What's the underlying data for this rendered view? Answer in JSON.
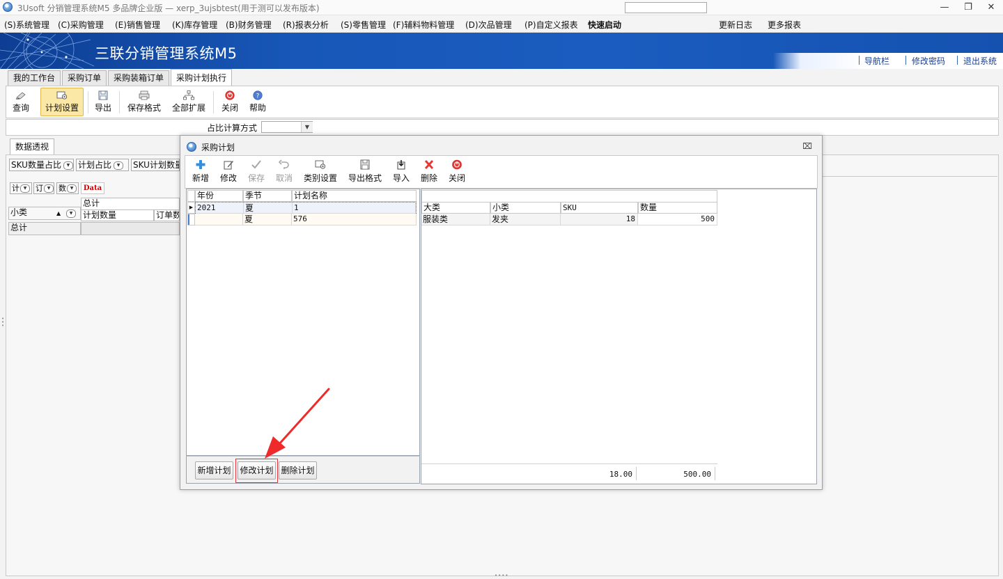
{
  "window": {
    "title": "3Usoft 分销管理系统M5 多品牌企业版 — xerp_3ujsbtest(用于测可以发布版本)",
    "minimize_icon": "minimize-icon",
    "restore_icon": "restore-icon",
    "close_icon": "close-icon"
  },
  "menu": {
    "items": [
      "(S)系统管理",
      "(C)采购管理",
      "(E)销售管理",
      "(K)库存管理",
      "(B)财务管理",
      "(R)报表分析",
      "(S)零售管理",
      "(F)辅料物料管理",
      "(D)次品管理",
      "(P)自定义报表"
    ],
    "quick_start_label": "快速启动",
    "quick_start_value": "",
    "update_log": "更新日志",
    "more_reports": "更多报表"
  },
  "banner": {
    "title": "三联分销管理系统M5",
    "nav_bar": "导航栏",
    "change_password": "修改密码",
    "exit_system": "退出系统"
  },
  "tabs": [
    "我的工作台",
    "采购订单",
    "采购装箱订单",
    "采购计划执行"
  ],
  "active_tab": "采购计划执行",
  "toolbar": {
    "query": "查询",
    "plan_settings": "计划设置",
    "export": "导出",
    "save_format": "保存格式",
    "expand_all": "全部扩展",
    "close": "关闭",
    "help": "帮助"
  },
  "ratio": {
    "label": "占比计算方式",
    "value": ""
  },
  "pivot": {
    "tab": "数据透视",
    "fields": [
      "SKU数量占比",
      "计划占比",
      "SKU计划数量"
    ],
    "small_fields": [
      "计",
      "订",
      "数"
    ],
    "data_label": "Data",
    "header_total": "总计",
    "col_plan_qty": "计划数量",
    "col_order_qty": "订单数",
    "row_field": "小类",
    "row_total": "总计"
  },
  "dialog": {
    "title": "采购计划",
    "toolbar": {
      "add": "新增",
      "edit": "修改",
      "save": "保存",
      "cancel": "取消",
      "category_settings": "类别设置",
      "export_format": "导出格式",
      "import": "导入",
      "delete": "删除",
      "close": "关闭"
    },
    "left_grid": {
      "headers": [
        "年份",
        "季节",
        "计划名称"
      ],
      "rows": [
        [
          "2021",
          "夏",
          "1"
        ],
        [
          "",
          "夏",
          "576"
        ]
      ]
    },
    "right_grid": {
      "headers": [
        "大类",
        "小类",
        "SKU",
        "数量"
      ],
      "rows": [
        [
          "服装类",
          "发夹",
          "18",
          "500"
        ]
      ],
      "footer": {
        "sku_total": "18.00",
        "qty_total": "500.00"
      }
    },
    "buttons": {
      "add_plan": "新增计划",
      "edit_plan": "修改计划",
      "delete_plan": "删除计划"
    }
  },
  "colors": {
    "banner_blue": "#1857b8",
    "highlight_red": "#e5323b",
    "selected_tool": "#fce8a6"
  }
}
